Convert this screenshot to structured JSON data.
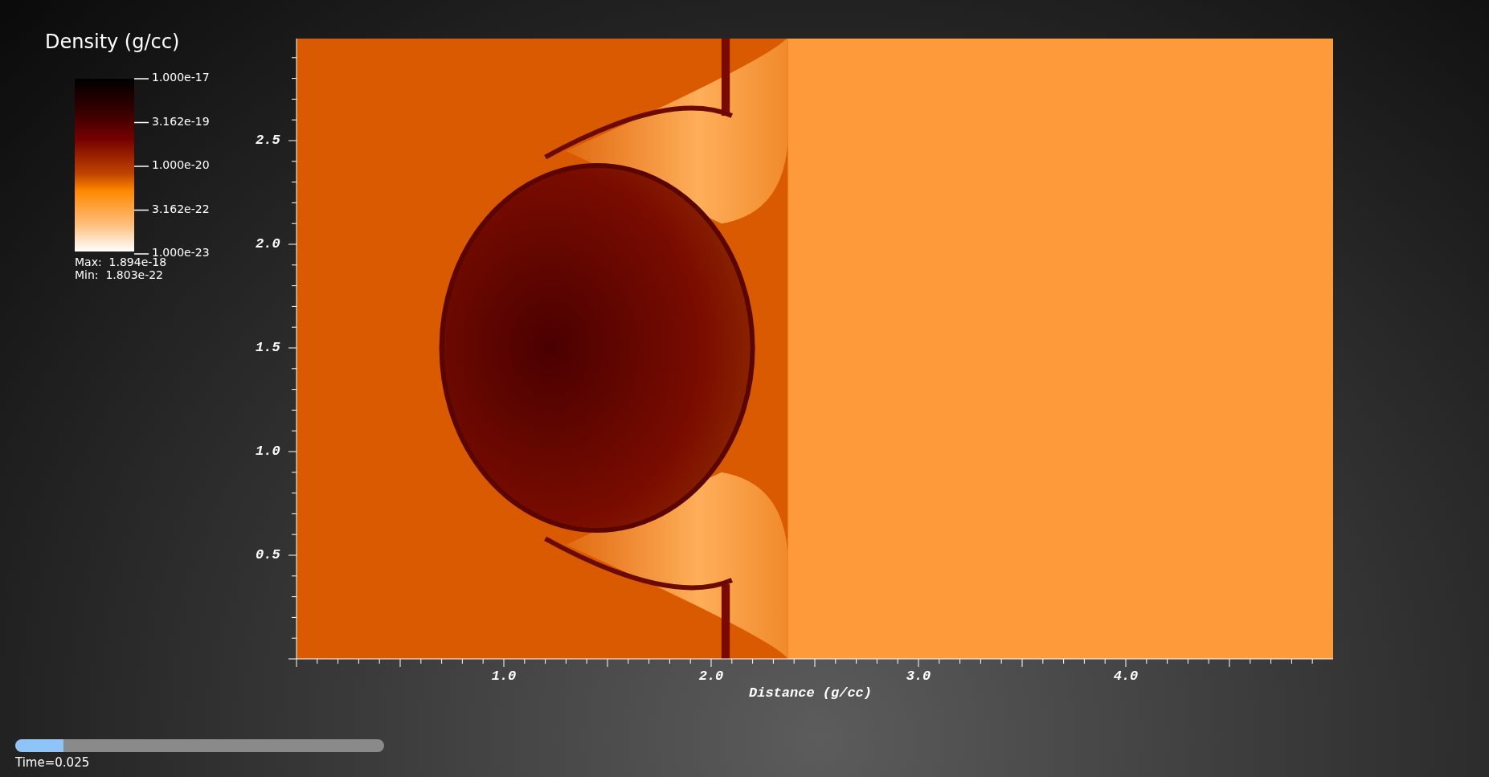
{
  "legend": {
    "title": "Density (g/cc)",
    "tick_labels": [
      "1.000e-17",
      "3.162e-19",
      "1.000e-20",
      "3.162e-22",
      "1.000e-23"
    ],
    "max_label": "Max:  1.894e-18",
    "min_label": "Min:  1.803e-22"
  },
  "plot": {
    "x_axis": {
      "title": "Distance (g/cc)",
      "tick_labels": [
        "1.0",
        "2.0",
        "3.0",
        "4.0"
      ]
    },
    "y_axis": {
      "tick_labels": [
        "2.5",
        "2.0",
        "1.5",
        "1.0",
        "0.5"
      ]
    }
  },
  "time_slider": {
    "level": 0.13,
    "label": "Time=0.025"
  }
}
